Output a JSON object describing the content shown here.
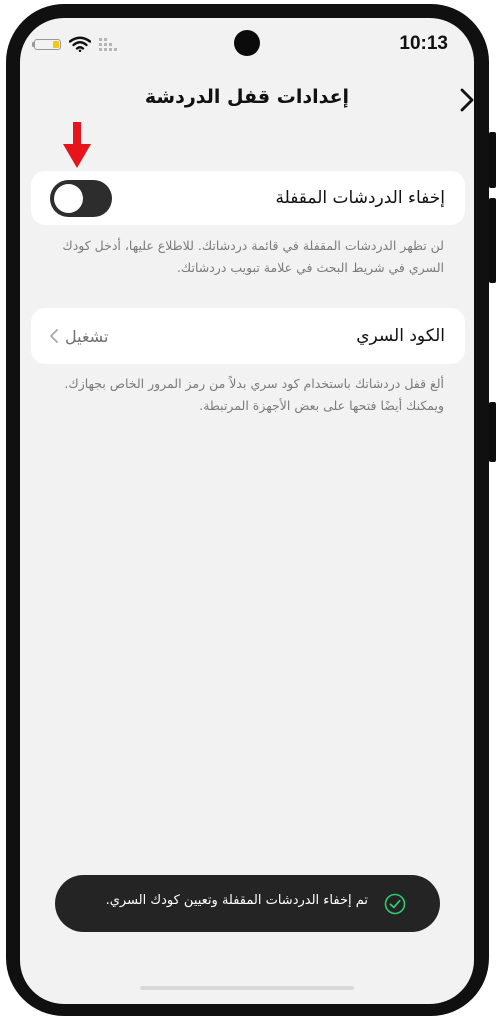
{
  "status_bar": {
    "time": "10:13"
  },
  "header": {
    "title": "إعدادات قفل الدردشة"
  },
  "hide_locked": {
    "label": "إخفاء الدردشات المقفلة",
    "enabled": false,
    "description": "لن تظهر الدردشات المقفلة في قائمة دردشاتك. للاطلاع عليها، أدخل كودك السري في شريط البحث في علامة تبويب دردشاتك."
  },
  "secret_code": {
    "label": "الكود السري",
    "value": "تشغيل",
    "description": "ألغ قفل دردشاتك باستخدام كود سري بدلاً من رمز المرور الخاص بجهازك. ويمكنك أيضًا فتحها على بعض الأجهزة المرتبطة."
  },
  "toast": {
    "message": "تم إخفاء الدردشات المقفلة وتعيين كودك السري."
  },
  "colors": {
    "annotation_arrow": "#e8141c",
    "battery_fill": "#f5c518",
    "toast_check": "#2ecc71"
  }
}
